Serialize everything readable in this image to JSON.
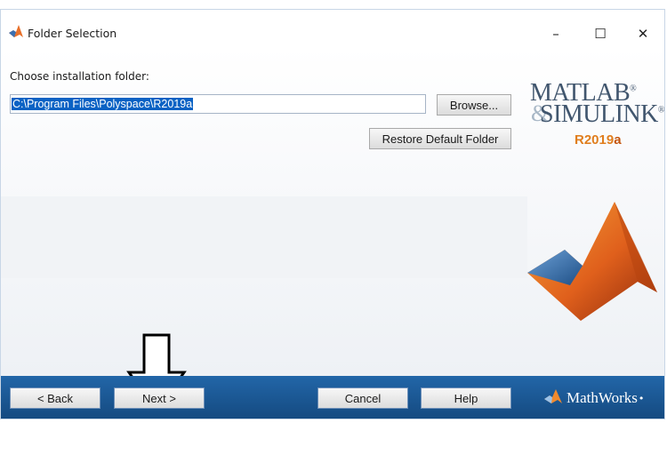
{
  "window": {
    "title": "Folder Selection",
    "minimize_glyph": "–",
    "maximize_glyph": "☐",
    "close_glyph": "✕"
  },
  "content": {
    "label": "Choose installation folder:",
    "folder_path": "C:\\Program Files\\Polyspace\\R2019a",
    "browse_label": "Browse...",
    "restore_label": "Restore Default Folder"
  },
  "logo": {
    "line1": "MATLAB",
    "line1_mark": "®",
    "ampersand": "&",
    "line2": "SIMULINK",
    "line2_mark": "®",
    "release_prefix": "R2019",
    "release_suffix": "a"
  },
  "footer": {
    "back_label": "< Back",
    "next_label": "Next >",
    "cancel_label": "Cancel",
    "help_label": "Help",
    "brand": "MathWorks",
    "brand_mark": "•"
  },
  "icons": {
    "app": "matlab-membrane-icon",
    "annotation": "down-arrow-icon"
  },
  "colors": {
    "selection": "#0a62c4",
    "footer_bar": "#1a5a98",
    "logo_text": "#41566e",
    "release_accent": "#e07e1e"
  }
}
